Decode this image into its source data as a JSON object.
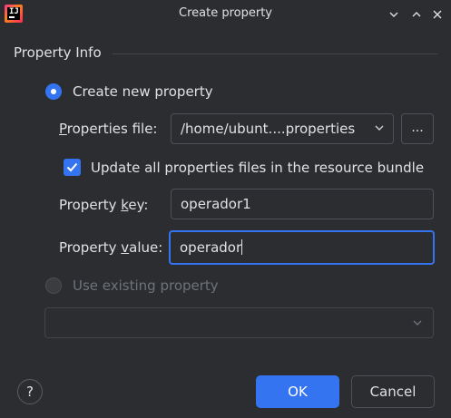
{
  "window": {
    "title": "Create property",
    "logo_text": "IJ"
  },
  "section": {
    "title": "Property Info"
  },
  "create_new": {
    "label": "Create new property",
    "selected": true
  },
  "properties_file": {
    "label_mnemonic": "P",
    "label_rest": "roperties file:",
    "value": "/home/ubunt....properties",
    "browse_label": "..."
  },
  "update_all": {
    "label": "Update all properties files in the resource bundle",
    "checked": true
  },
  "property_key": {
    "label_before": "Property ",
    "label_mnemonic": "k",
    "label_after": "ey:",
    "value": "operador1"
  },
  "property_value": {
    "label_before": "Property ",
    "label_mnemonic": "v",
    "label_after": "alue:",
    "value": "operador"
  },
  "use_existing": {
    "label": "Use existing property",
    "selected": false,
    "enabled": false
  },
  "buttons": {
    "help": "?",
    "ok": "OK",
    "cancel": "Cancel"
  },
  "colors": {
    "accent": "#3574f0",
    "background": "#2b2d30",
    "text": "#dfe1e5",
    "disabled": "#6f737a"
  }
}
